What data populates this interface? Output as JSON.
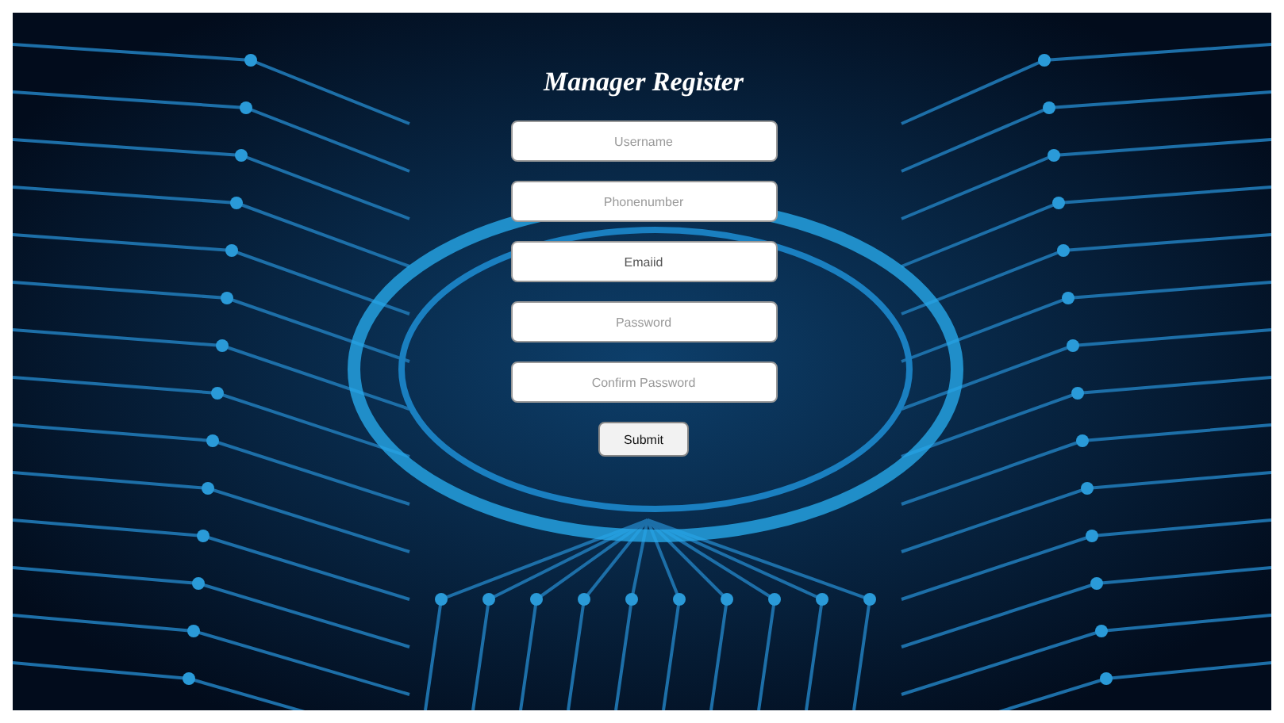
{
  "title": "Manager Register",
  "fields": [
    {
      "placeholder": "Username"
    },
    {
      "placeholder": "Phonenumber"
    },
    {
      "value": "Emaiid"
    },
    {
      "placeholder": "Password"
    },
    {
      "placeholder": "Confirm Password"
    }
  ],
  "submit": "Submit"
}
